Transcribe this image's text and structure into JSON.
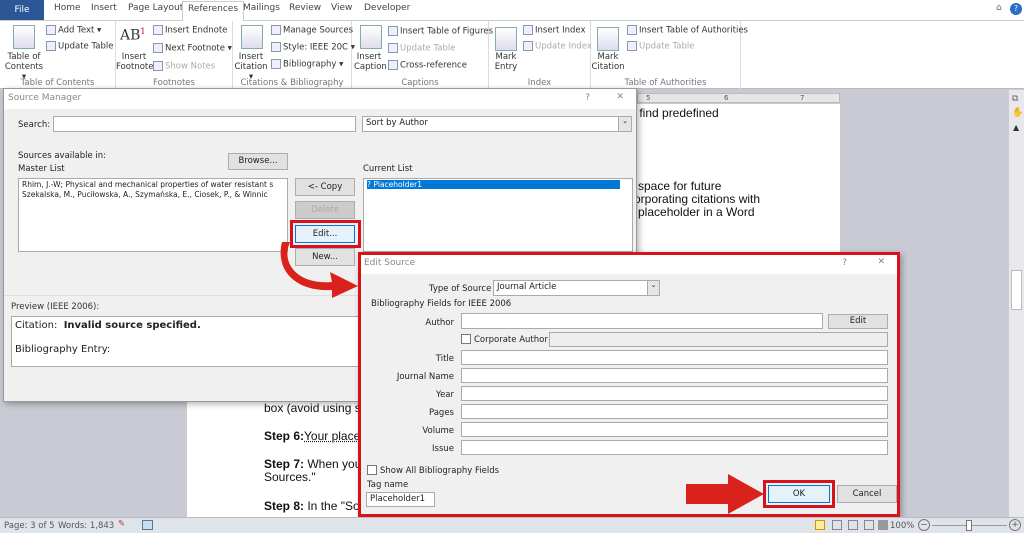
{
  "tabs": {
    "file": "File",
    "items": [
      "Home",
      "Insert",
      "Page Layout",
      "References",
      "Mailings",
      "Review",
      "View",
      "Developer"
    ],
    "active": "References"
  },
  "ribbon": {
    "toc": {
      "label": "Table of Contents",
      "big": "Table of Contents ▾",
      "add_text": "Add Text ▾",
      "update": "Update Table"
    },
    "footnotes": {
      "label": "Footnotes",
      "big": "Insert Footnote",
      "endnote": "Insert Endnote",
      "next": "Next Footnote ▾",
      "show": "Show Notes"
    },
    "citations": {
      "label": "Citations & Bibliography",
      "big": "Insert Citation ▾",
      "manage": "Manage Sources",
      "style_label": "Style:",
      "style_value": "IEEE 20C ▾",
      "bib": "Bibliography ▾"
    },
    "captions": {
      "label": "Captions",
      "big": "Insert Caption",
      "tof": "Insert Table of Figures",
      "update": "Update Table",
      "xref": "Cross-reference"
    },
    "index": {
      "label": "Index",
      "big": "Mark Entry",
      "insert": "Insert Index",
      "update": "Update Index"
    },
    "toa": {
      "label": "Table of Authorities",
      "big": "Mark Citation",
      "insert": "Insert Table of Authorities",
      "update": "Update Table"
    }
  },
  "ruler": [
    "5",
    "6",
    "7"
  ],
  "document": {
    "lines": [
      "y find predefined",
      "space for future",
      "orporating citations with",
      "placeholder in a Word",
      "box (avoid using s",
      "Step 6:",
      "Your place",
      "Step 7:",
      " When you",
      "Sources.\"",
      "Step 8:",
      " In the \"So"
    ]
  },
  "source_manager": {
    "title": "Source Manager",
    "help": "?",
    "close": "✕",
    "search_label": "Search:",
    "search_value": "",
    "sort": "Sort by Author",
    "sources_label": "Sources available in:",
    "master_label": "Master List",
    "browse": "Browse...",
    "master_items": [
      "Rhim, J.-W; Physical and mechanical properties of water resistant s",
      "Szekalska, M., Puciłowska, A., Szymańska, E., Ciosek, P., & Winnic"
    ],
    "copy": "<- Copy",
    "delete": "Delete",
    "edit": "Edit...",
    "new": "New...",
    "current_label": "Current List",
    "current_items": [
      "? Placeholder1"
    ],
    "preview_label": "Preview (IEEE 2006):",
    "citation_label": "Citation:",
    "citation_value": "Invalid source specified.",
    "bib_label": "Bibliography Entry:"
  },
  "edit_source": {
    "title": "Edit Source",
    "help": "?",
    "close": "✕",
    "type_label": "Type of Source",
    "type_value": "Journal Article",
    "fields_label": "Bibliography Fields for IEEE 2006",
    "author_label": "Author",
    "author_edit": "Edit",
    "corporate": "Corporate Author",
    "fields": [
      "Title",
      "Journal Name",
      "Year",
      "Pages",
      "Volume",
      "Issue"
    ],
    "show_all": "Show All Bibliography Fields",
    "tag_label": "Tag name",
    "tag_value": "Placeholder1",
    "ok": "OK",
    "cancel": "Cancel"
  },
  "status": {
    "page": "Page: 3 of 5",
    "words": "Words: 1,843",
    "zoom": "100%"
  },
  "colors": {
    "highlight": "#d8121b",
    "file_tab": "#2b5797",
    "selection": "#0078d7"
  }
}
